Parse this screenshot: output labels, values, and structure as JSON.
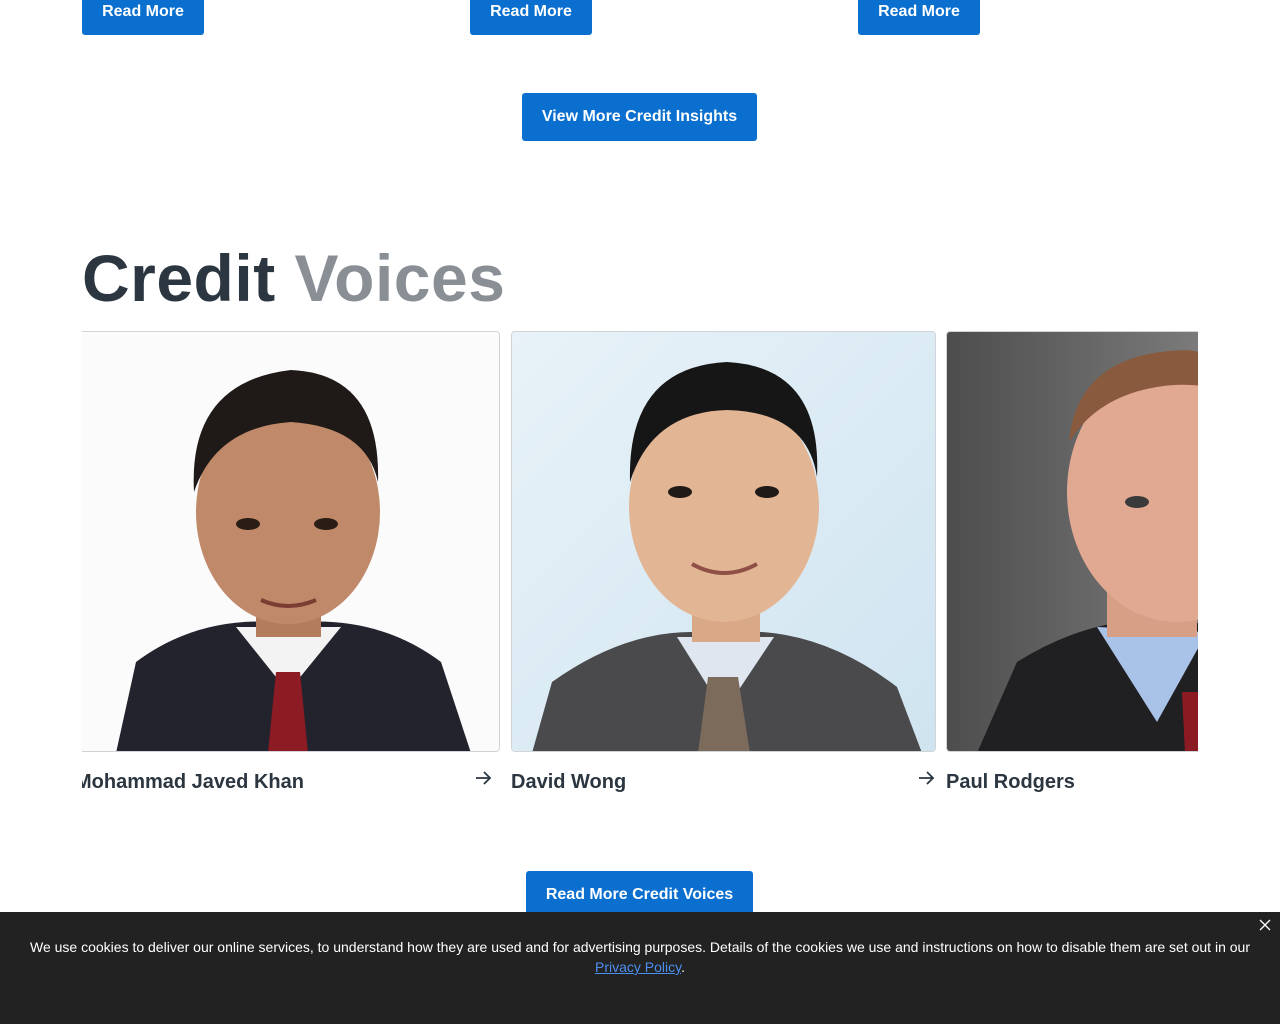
{
  "insights": {
    "read_more_labels": [
      "Read More",
      "Read More",
      "Read More"
    ],
    "view_more_label": "View More Credit Insights"
  },
  "voices": {
    "title_part1": "Credit",
    "title_part2": "Voices",
    "people": [
      {
        "name": "Mohammad Javed Khan"
      },
      {
        "name": "David Wong"
      },
      {
        "name": "Paul Rodgers"
      }
    ],
    "read_more_label": "Read More Credit Voices"
  },
  "cookie": {
    "message": "We use cookies to deliver our online services, to understand how they are used and for advertising purposes. Details of the cookies we use and instructions on how to disable them are set out in our ",
    "link_text": "Privacy Policy",
    "suffix": "."
  },
  "icons": {
    "arrow": "arrow-right-icon",
    "close": "close-icon"
  },
  "colors": {
    "accent": "#0a6fce",
    "title_dark": "#2b3640",
    "title_grey": "#8a8f95",
    "cookie_bg": "#222222",
    "link": "#4d8ff0"
  }
}
